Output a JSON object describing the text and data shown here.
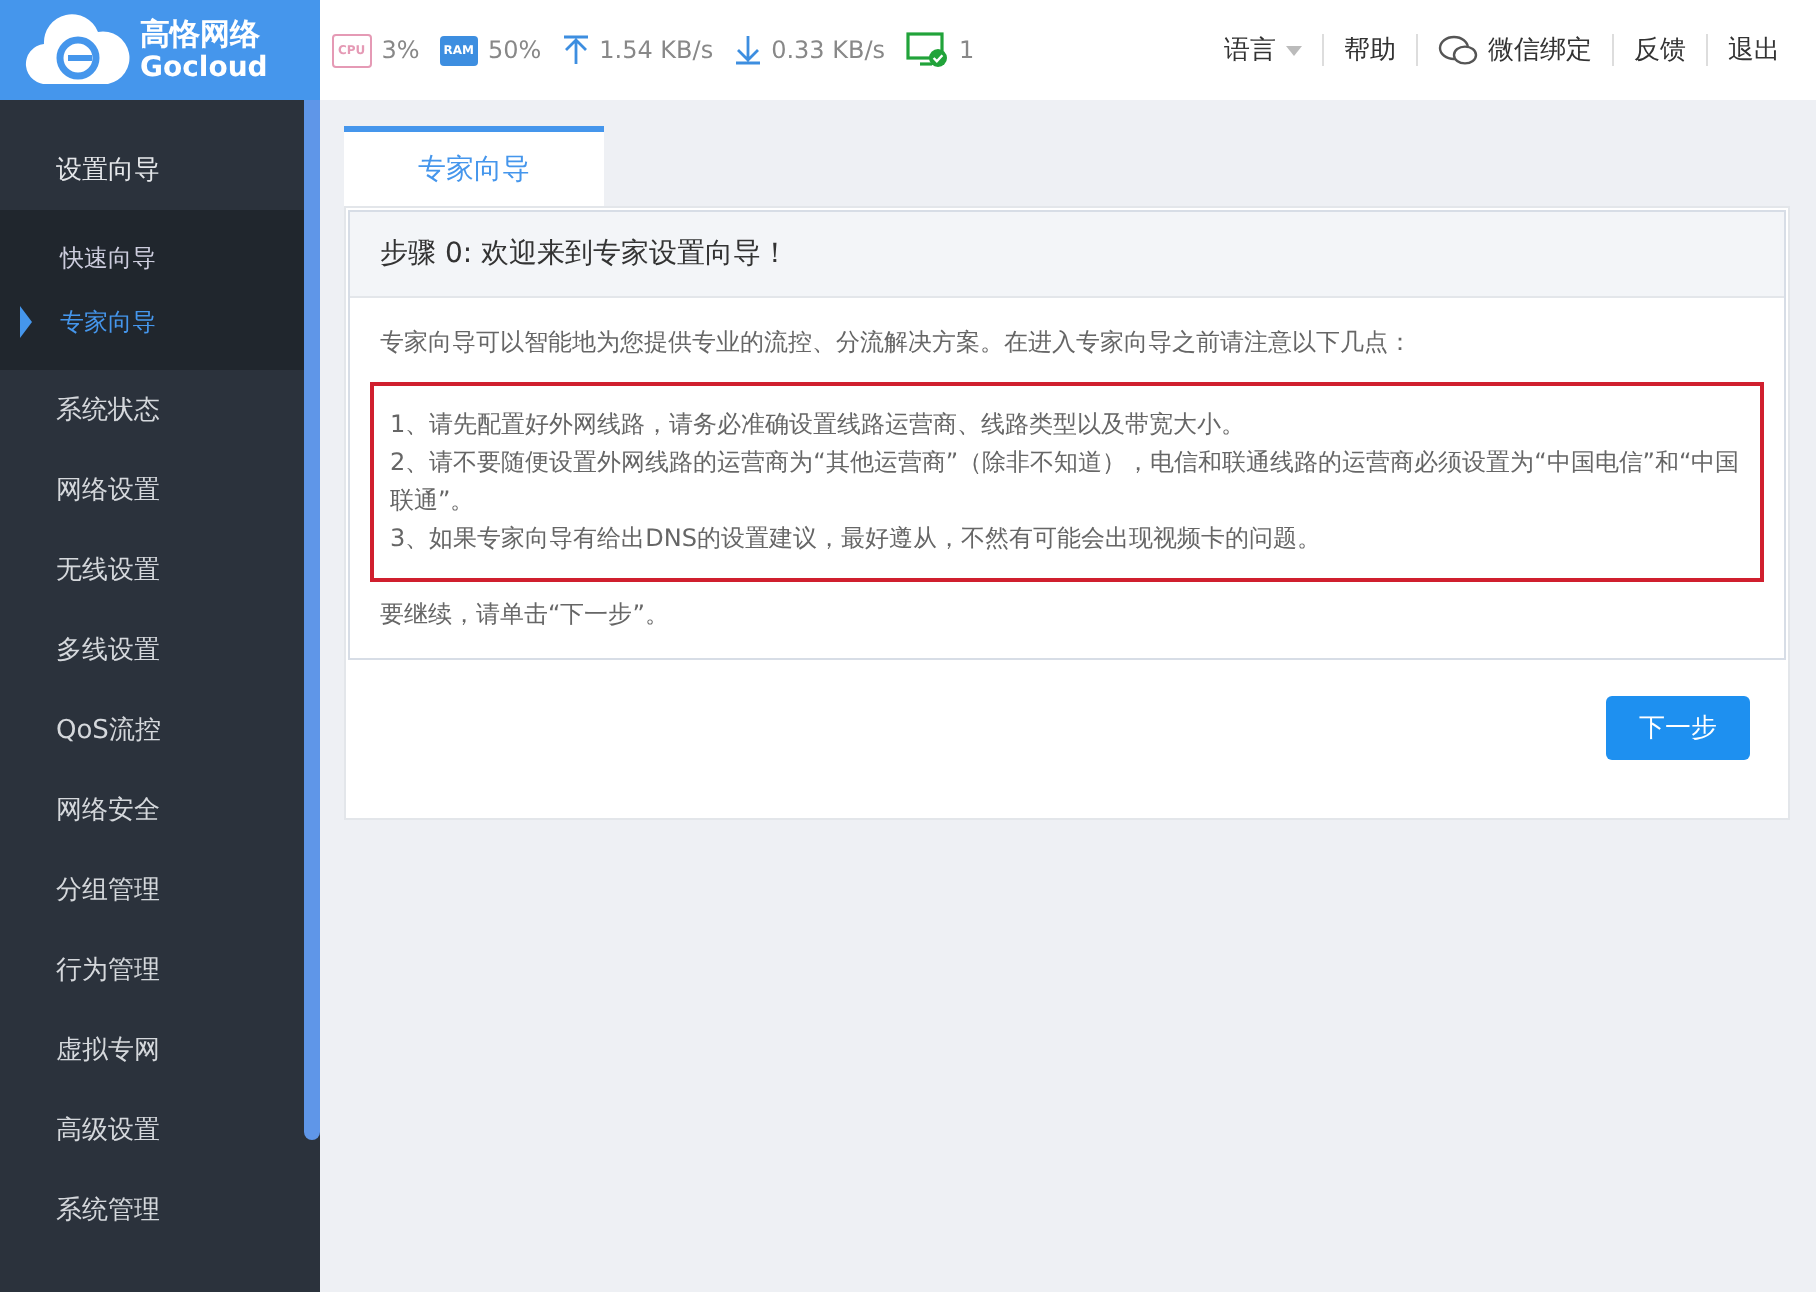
{
  "logo": {
    "name": "高恪网络",
    "sub": "Gocloud"
  },
  "status": {
    "cpu_label": "CPU",
    "cpu": "3%",
    "ram_label": "RAM",
    "ram": "50%",
    "up": "1.54 KB/s",
    "down": "0.33 KB/s",
    "devices": "1"
  },
  "top_links": [
    {
      "kind": "dropdown",
      "label": "语言"
    },
    {
      "kind": "link",
      "label": "帮助"
    },
    {
      "kind": "wechat",
      "label": "微信绑定"
    },
    {
      "kind": "link",
      "label": "反馈"
    },
    {
      "kind": "link",
      "label": "退出"
    }
  ],
  "sidebar": {
    "items": [
      {
        "label": "设置向导",
        "expanded": true,
        "children": [
          {
            "label": "快速向导",
            "selected": false
          },
          {
            "label": "专家向导",
            "selected": true
          }
        ]
      },
      {
        "label": "系统状态",
        "expanded": false
      },
      {
        "label": "网络设置",
        "expanded": false
      },
      {
        "label": "无线设置",
        "expanded": false
      },
      {
        "label": "多线设置",
        "expanded": false
      },
      {
        "label": "QoS流控",
        "expanded": false
      },
      {
        "label": "网络安全",
        "expanded": false
      },
      {
        "label": "分组管理",
        "expanded": false
      },
      {
        "label": "行为管理",
        "expanded": false
      },
      {
        "label": "虚拟专网",
        "expanded": false
      },
      {
        "label": "高级设置",
        "expanded": false
      },
      {
        "label": "系统管理",
        "expanded": false
      }
    ]
  },
  "tabs": [
    {
      "label": "专家向导",
      "selected": true
    }
  ],
  "panel": {
    "heading": "步骤 0: 欢迎来到专家设置向导！",
    "intro": "专家向导可以智能地为您提供专业的流控、分流解决方案。在进入专家向导之前请注意以下几点：",
    "notes": [
      "1、请先配置好外网线路，请务必准确设置线路运营商、线路类型以及带宽大小。",
      "2、请不要随便设置外网线路的运营商为“其他运营商”（除非不知道），电信和联通线路的运营商必须设置为“中国电信”和“中国联通”。",
      "3、如果专家向导有给出DNS的设置建议，最好遵从，不然有可能会出现视频卡的问题。"
    ],
    "outro": "要继续，请单击“下一步”。"
  },
  "next_button": "下一步"
}
